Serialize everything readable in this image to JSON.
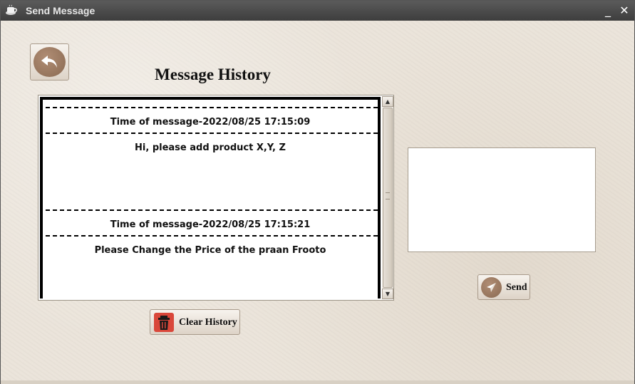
{
  "window": {
    "title": "Send Message",
    "minimize_glyph": "_",
    "close_glyph": "✕",
    "app_icon": "coffee-cup-icon"
  },
  "toolbar": {
    "back_icon": "reply-arrow-icon"
  },
  "history": {
    "heading": "Message History",
    "messages": [
      {
        "time": "Time of message-2022/08/25 17:15:09",
        "text": "Hi, please add product X,Y, Z"
      },
      {
        "time": "Time of message-2022/08/25 17:15:21",
        "text": "Please Change the Price of the praan Frooto"
      }
    ],
    "clear_label": "Clear History",
    "clear_icon": "trash-icon"
  },
  "compose": {
    "value": "",
    "send_label": "Send",
    "send_icon": "paper-plane-icon"
  },
  "colors": {
    "titlebar": "#4a4a4a",
    "background": "#ebe4da",
    "accent_brown": "#9c7a62",
    "trash_red": "#d9473a"
  }
}
